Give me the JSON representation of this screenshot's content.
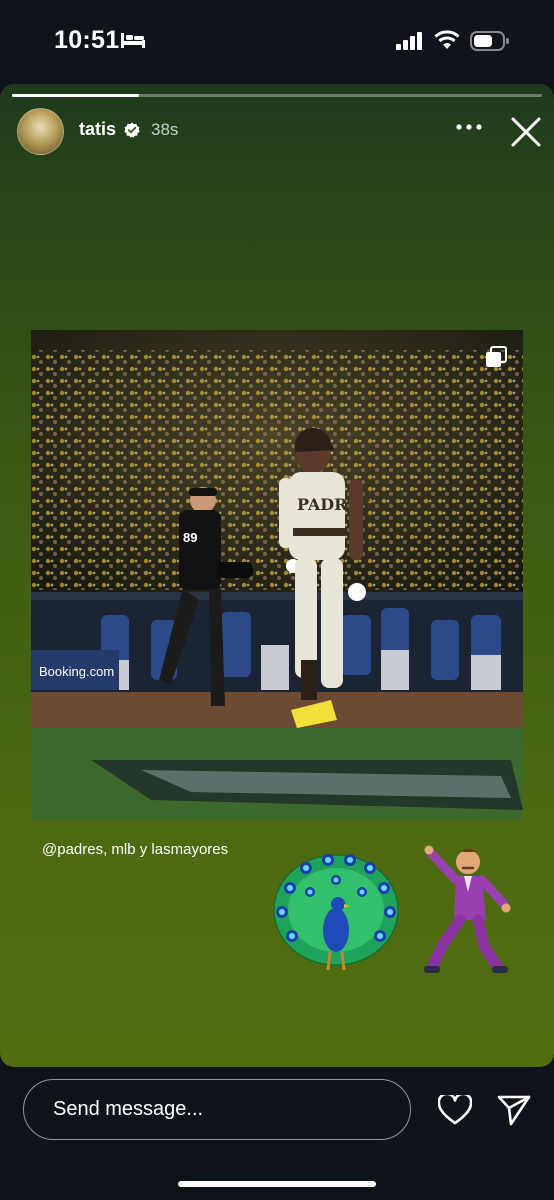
{
  "status_bar": {
    "time": "10:51",
    "focus_icon": "bed-icon",
    "signal_icon": "signal-icon",
    "wifi_icon": "wifi-icon",
    "battery_icon": "battery-icon"
  },
  "story": {
    "progress": 0.24,
    "username": "tatis",
    "verified_icon": "verified-badge-icon",
    "timestamp": "38s",
    "more_icon": "more-icon",
    "close_icon": "close-icon",
    "post": {
      "image_description_icon": "photo",
      "carousel_icon": "carousel-icon",
      "stadium_sign": "Booking.com",
      "jersey_text": "PADRES",
      "umpire_number": "89"
    },
    "caption": "@padres, mlb y lasmayores",
    "stickers": [
      "peacock-emoji",
      "man-dancing-emoji"
    ]
  },
  "message_bar": {
    "placeholder": "Send message...",
    "like_icon": "heart-icon",
    "send_icon": "send-icon"
  },
  "colors": {
    "background": "#0f141a",
    "story_gradient_top": "#1f3a1c",
    "story_gradient_bottom": "#516d10"
  }
}
